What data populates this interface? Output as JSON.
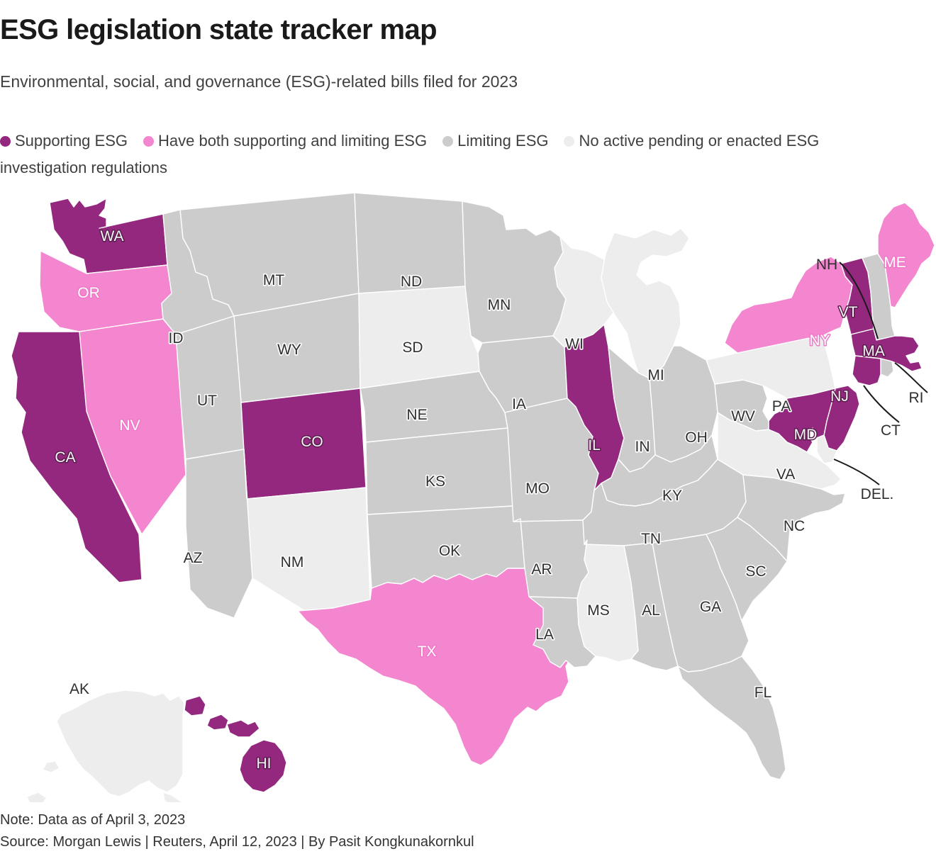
{
  "header": {
    "title": "ESG legislation state tracker map",
    "subtitle": "Environmental, social, and governance (ESG)-related bills filed for 2023"
  },
  "legend": {
    "items": [
      {
        "label": "Supporting ESG",
        "color": "#93287E",
        "icon": "legend-dot-supporting"
      },
      {
        "label": "Have both supporting and limiting ESG",
        "color": "#F486D0",
        "icon": "legend-dot-both"
      },
      {
        "label": "Limiting ESG",
        "color": "#CCCCCC",
        "icon": "legend-dot-limiting"
      },
      {
        "label": "No active pending or enacted ESG",
        "color": "#EDEDED",
        "icon": "legend-dot-none"
      }
    ],
    "continuation": "investigation regulations"
  },
  "footer": {
    "note": "Note: Data as of April 3, 2023",
    "source": "Source: Morgan Lewis | Reuters, April 12, 2023 | By Pasit Kongkunakornkul"
  },
  "colors": {
    "supporting": "#93287E",
    "both": "#F486D0",
    "limiting": "#CCCCCC",
    "none": "#EDEDED",
    "border": "#FFFFFF"
  },
  "chart_data": {
    "type": "map",
    "title": "ESG legislation state tracker map",
    "subtitle": "Environmental, social, and governance (ESG)-related bills filed for 2023",
    "legend_position": "top",
    "categories": [
      "Supporting ESG",
      "Have both supporting and limiting ESG",
      "Limiting ESG",
      "No active pending or enacted ESG investigation regulations"
    ],
    "category_colors": [
      "#93287E",
      "#F486D0",
      "#CCCCCC",
      "#EDEDED"
    ],
    "values": {
      "AL": "Limiting ESG",
      "AK": "No active pending or enacted ESG investigation regulations",
      "AZ": "Limiting ESG",
      "AR": "Limiting ESG",
      "CA": "Supporting ESG",
      "CO": "Supporting ESG",
      "CT": "Supporting ESG",
      "DE": "No active pending or enacted ESG investigation regulations",
      "FL": "Limiting ESG",
      "GA": "Limiting ESG",
      "HI": "Supporting ESG",
      "ID": "Limiting ESG",
      "IL": "Supporting ESG",
      "IN": "Limiting ESG",
      "IA": "Limiting ESG",
      "KS": "Limiting ESG",
      "KY": "Limiting ESG",
      "LA": "Limiting ESG",
      "ME": "Have both supporting and limiting ESG",
      "MD": "Supporting ESG",
      "MA": "Supporting ESG",
      "MI": "No active pending or enacted ESG investigation regulations",
      "MN": "Limiting ESG",
      "MS": "No active pending or enacted ESG investigation regulations",
      "MO": "Limiting ESG",
      "MT": "Limiting ESG",
      "NE": "Limiting ESG",
      "NV": "Have both supporting and limiting ESG",
      "NH": "Limiting ESG",
      "NJ": "Supporting ESG",
      "NM": "No active pending or enacted ESG investigation regulations",
      "NY": "Have both supporting and limiting ESG",
      "NC": "Limiting ESG",
      "ND": "Limiting ESG",
      "OH": "Limiting ESG",
      "OK": "Limiting ESG",
      "OR": "Have both supporting and limiting ESG",
      "PA": "No active pending or enacted ESG investigation regulations",
      "RI": "Limiting ESG",
      "SC": "Limiting ESG",
      "SD": "No active pending or enacted ESG investigation regulations",
      "TN": "Limiting ESG",
      "TX": "Have both supporting and limiting ESG",
      "UT": "Limiting ESG",
      "VT": "Supporting ESG",
      "VA": "No active pending or enacted ESG investigation regulations",
      "WA": "Supporting ESG",
      "WV": "Limiting ESG",
      "WI": "No active pending or enacted ESG investigation regulations",
      "WY": "Limiting ESG"
    }
  },
  "map": {
    "labels": [
      {
        "code": "WA",
        "text": "WA"
      },
      {
        "code": "OR",
        "text": "OR"
      },
      {
        "code": "CA",
        "text": "CA"
      },
      {
        "code": "NV",
        "text": "NV"
      },
      {
        "code": "ID",
        "text": "ID"
      },
      {
        "code": "MT",
        "text": "MT"
      },
      {
        "code": "WY",
        "text": "WY"
      },
      {
        "code": "UT",
        "text": "UT"
      },
      {
        "code": "AZ",
        "text": "AZ"
      },
      {
        "code": "NM",
        "text": "NM"
      },
      {
        "code": "CO",
        "text": "CO"
      },
      {
        "code": "ND",
        "text": "ND"
      },
      {
        "code": "SD",
        "text": "SD"
      },
      {
        "code": "NE",
        "text": "NE"
      },
      {
        "code": "KS",
        "text": "KS"
      },
      {
        "code": "OK",
        "text": "OK"
      },
      {
        "code": "TX",
        "text": "TX"
      },
      {
        "code": "MN",
        "text": "MN"
      },
      {
        "code": "IA",
        "text": "IA"
      },
      {
        "code": "MO",
        "text": "MO"
      },
      {
        "code": "AR",
        "text": "AR"
      },
      {
        "code": "LA",
        "text": "LA"
      },
      {
        "code": "WI",
        "text": "WI"
      },
      {
        "code": "IL",
        "text": "IL"
      },
      {
        "code": "MI",
        "text": "MI"
      },
      {
        "code": "IN",
        "text": "IN"
      },
      {
        "code": "OH",
        "text": "OH"
      },
      {
        "code": "KY",
        "text": "KY"
      },
      {
        "code": "TN",
        "text": "TN"
      },
      {
        "code": "MS",
        "text": "MS"
      },
      {
        "code": "AL",
        "text": "AL"
      },
      {
        "code": "GA",
        "text": "GA"
      },
      {
        "code": "FL",
        "text": "FL"
      },
      {
        "code": "SC",
        "text": "SC"
      },
      {
        "code": "NC",
        "text": "NC"
      },
      {
        "code": "VA",
        "text": "VA"
      },
      {
        "code": "WV",
        "text": "WV"
      },
      {
        "code": "PA",
        "text": "PA"
      },
      {
        "code": "NY",
        "text": "NY"
      },
      {
        "code": "VT",
        "text": "VT"
      },
      {
        "code": "ME",
        "text": "ME"
      },
      {
        "code": "MA",
        "text": "MA"
      },
      {
        "code": "NJ",
        "text": "NJ"
      },
      {
        "code": "MD",
        "text": "MD"
      },
      {
        "code": "AK",
        "text": "AK"
      },
      {
        "code": "HI",
        "text": "HI"
      }
    ],
    "callouts": [
      {
        "code": "NH",
        "text": "NH"
      },
      {
        "code": "RI",
        "text": "RI"
      },
      {
        "code": "CT",
        "text": "CT"
      },
      {
        "code": "DEL",
        "text": "DEL."
      }
    ]
  }
}
